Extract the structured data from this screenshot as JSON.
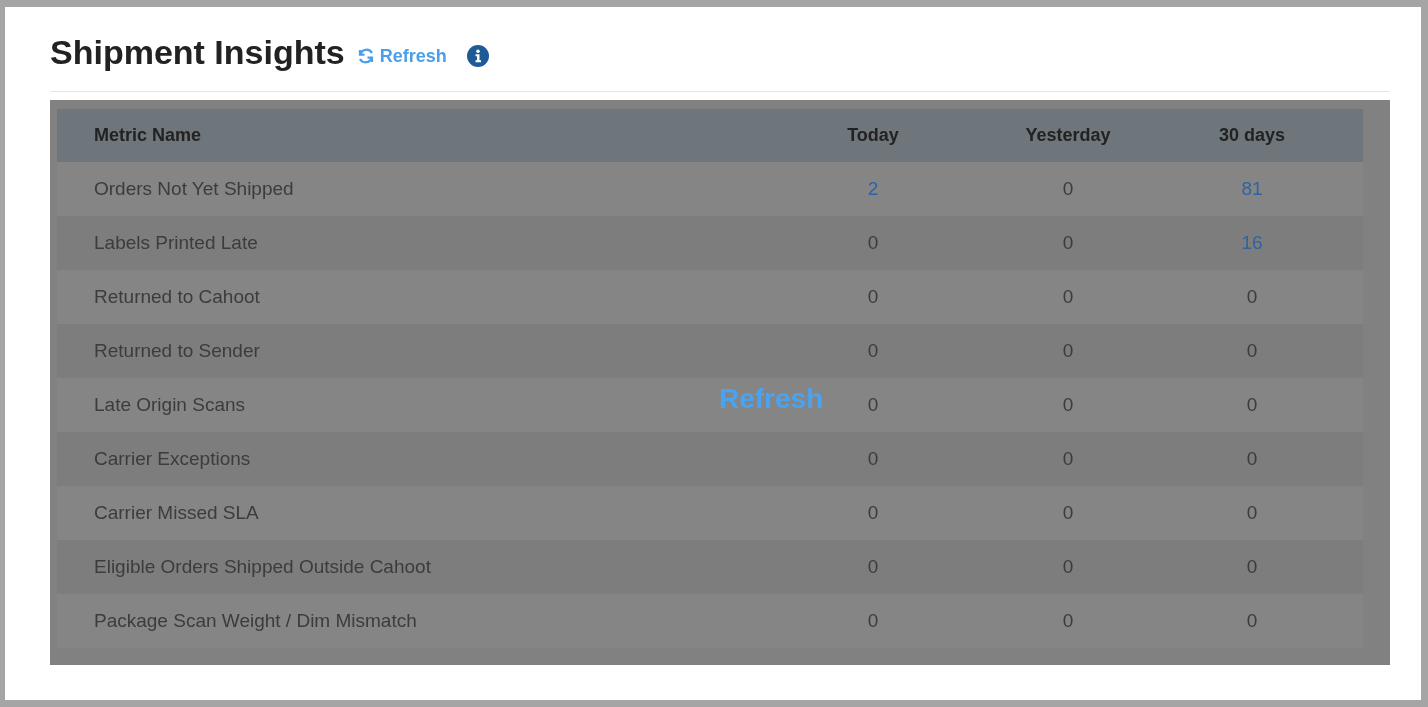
{
  "header": {
    "title": "Shipment Insights",
    "refresh_link": "Refresh"
  },
  "table": {
    "columns": [
      "Metric Name",
      "Today",
      "Yesterday",
      "30 days"
    ],
    "rows": [
      {
        "cells": [
          {
            "text": "Orders Not Yet Shipped"
          },
          {
            "text": "2",
            "link": true
          },
          {
            "text": "0",
            "link": false
          },
          {
            "text": "81",
            "link": true
          }
        ]
      },
      {
        "cells": [
          {
            "text": "Labels Printed Late"
          },
          {
            "text": "0",
            "link": false
          },
          {
            "text": "0",
            "link": false
          },
          {
            "text": "16",
            "link": true
          }
        ]
      },
      {
        "cells": [
          {
            "text": "Returned to Cahoot"
          },
          {
            "text": "0",
            "link": false
          },
          {
            "text": "0",
            "link": false
          },
          {
            "text": "0",
            "link": false
          }
        ]
      },
      {
        "cells": [
          {
            "text": "Returned to Sender"
          },
          {
            "text": "0",
            "link": false
          },
          {
            "text": "0",
            "link": false
          },
          {
            "text": "0",
            "link": false
          }
        ]
      },
      {
        "cells": [
          {
            "text": "Late Origin Scans"
          },
          {
            "text": "0",
            "link": false
          },
          {
            "text": "0",
            "link": false
          },
          {
            "text": "0",
            "link": false
          }
        ]
      },
      {
        "cells": [
          {
            "text": "Carrier Exceptions"
          },
          {
            "text": "0",
            "link": false
          },
          {
            "text": "0",
            "link": false
          },
          {
            "text": "0",
            "link": false
          }
        ]
      },
      {
        "cells": [
          {
            "text": "Carrier Missed SLA"
          },
          {
            "text": "0",
            "link": false
          },
          {
            "text": "0",
            "link": false
          },
          {
            "text": "0",
            "link": false
          }
        ]
      },
      {
        "cells": [
          {
            "text": "Eligible Orders Shipped Outside Cahoot"
          },
          {
            "text": "0",
            "link": false
          },
          {
            "text": "0",
            "link": false
          },
          {
            "text": "0",
            "link": false
          }
        ]
      },
      {
        "cells": [
          {
            "text": "Package Scan Weight / Dim Mismatch"
          },
          {
            "text": "0",
            "link": false
          },
          {
            "text": "0",
            "link": false
          },
          {
            "text": "0",
            "link": false
          }
        ]
      }
    ]
  },
  "overlay": {
    "text": "Refresh"
  }
}
